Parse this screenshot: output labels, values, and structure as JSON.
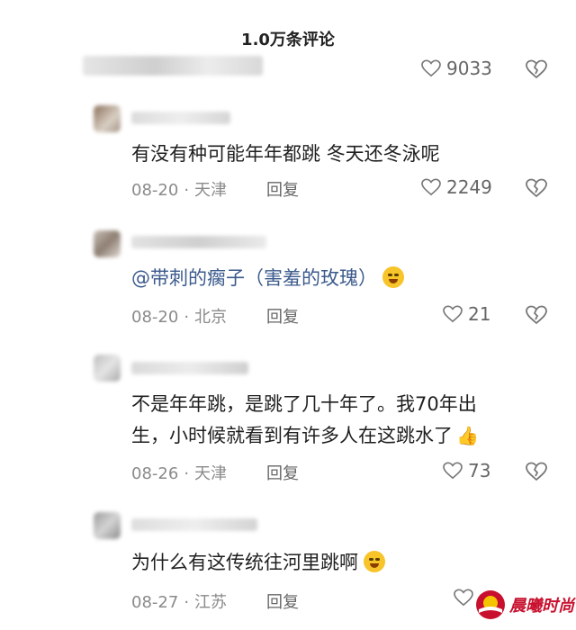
{
  "header": {
    "title": "1.0万条评论"
  },
  "top_comment": {
    "likes": "9033"
  },
  "comments": [
    {
      "text": "有没有种可能年年都跳 冬天还冬泳呢",
      "date": "08-20",
      "location": "天津",
      "reply_label": "回复",
      "likes": "2249"
    },
    {
      "mention": "@带刺的瘸子（害羞的玫瑰）",
      "date": "08-20",
      "location": "北京",
      "reply_label": "回复",
      "likes": "21"
    },
    {
      "text_line1": "不是年年跳，是跳了几十年了。我70年出",
      "text_line2": "生，小时候就看到有许多人在这跳水了",
      "date": "08-26",
      "location": "天津",
      "reply_label": "回复",
      "likes": "73"
    },
    {
      "text": "为什么有这传统往河里跳啊",
      "date": "08-27",
      "location": "江苏",
      "reply_label": "回复",
      "likes": ""
    }
  ],
  "watermark": {
    "text": "晨曦时尚"
  },
  "icons": {
    "heart": "heart-outline-icon",
    "dislike": "broken-heart-icon",
    "emoji_shy": "shy-face-emoji",
    "emoji_laugh": "laughing-emoji",
    "thumbs_up": "thumbs-up-emoji"
  },
  "colors": {
    "mention": "#3b5a8c",
    "meta": "#8a8a8a",
    "watermark": "#c8102e"
  }
}
